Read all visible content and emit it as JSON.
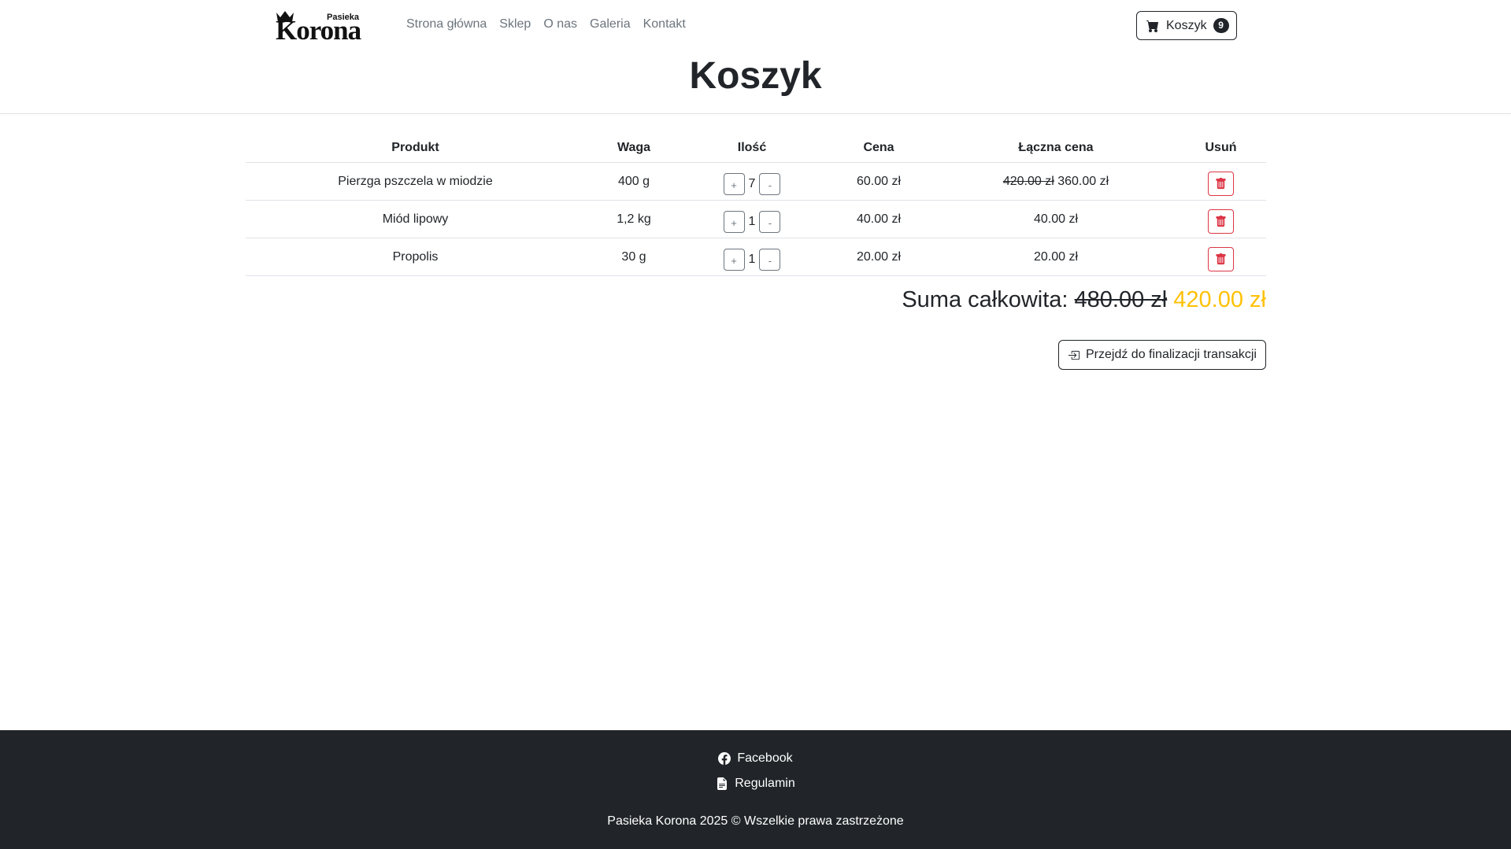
{
  "brand": {
    "small": "Pasieka",
    "big": "Korona"
  },
  "nav": {
    "items": [
      "Strona główna",
      "Sklep",
      "O nas",
      "Galeria",
      "Kontakt"
    ]
  },
  "cart_button": {
    "label": "Koszyk",
    "count": "9",
    "icon": "cart-icon"
  },
  "page_title": "Koszyk",
  "table": {
    "headers": {
      "product": "Produkt",
      "weight": "Waga",
      "quantity": "Ilość",
      "price": "Cena",
      "total": "Łączna cena",
      "remove": "Usuń"
    },
    "rows": [
      {
        "product": "Pierzga pszczela w miodzie",
        "weight": "400 g",
        "quantity": "7",
        "price": "60.00 zł",
        "total_old": "420.00 zł",
        "total": "360.00 zł"
      },
      {
        "product": "Miód lipowy",
        "weight": "1,2 kg",
        "quantity": "1",
        "price": "40.00 zł",
        "total_old": "",
        "total": "40.00 zł"
      },
      {
        "product": "Propolis",
        "weight": "30 g",
        "quantity": "1",
        "price": "20.00 zł",
        "total_old": "",
        "total": "20.00 zł"
      }
    ],
    "plus_label": "+",
    "minus_label": "-"
  },
  "summary": {
    "label": "Suma całkowita:",
    "old_total": "480.00 zł",
    "new_total": "420.00 zł"
  },
  "checkout": {
    "label": "Przejdź do finalizacji transakcji",
    "icon": "sign-in-icon"
  },
  "footer": {
    "facebook": "Facebook",
    "terms": "Regulamin",
    "copyright": "Pasieka Korona 2025 © Wszelkie prawa zastrzeżone"
  },
  "colors": {
    "accent": "#ffc107",
    "danger": "#dc3545",
    "dark": "#212529",
    "muted": "#6c757d"
  }
}
